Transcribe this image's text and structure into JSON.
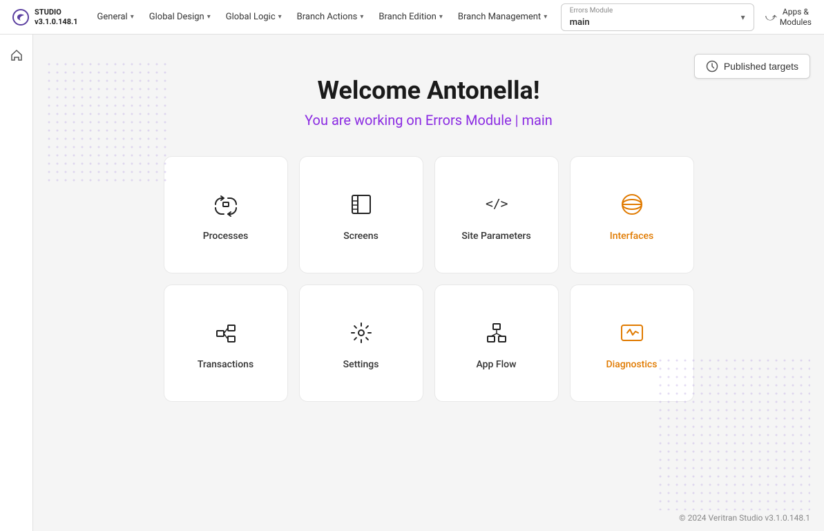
{
  "app": {
    "name": "STUDIO",
    "version": "v3.1.0.148.1"
  },
  "nav": {
    "items": [
      {
        "id": "general",
        "label": "General",
        "hasDropdown": true
      },
      {
        "id": "global-design",
        "label": "Global Design",
        "hasDropdown": true
      },
      {
        "id": "global-logic",
        "label": "Global Logic",
        "hasDropdown": true
      },
      {
        "id": "branch-actions",
        "label": "Branch Actions",
        "hasDropdown": true
      },
      {
        "id": "branch-edition",
        "label": "Branch Edition",
        "hasDropdown": true
      },
      {
        "id": "branch-management",
        "label": "Branch Management",
        "hasDropdown": true
      }
    ],
    "module": {
      "label": "Errors Module",
      "value": "main"
    },
    "apps": {
      "label": "Apps &\nModules",
      "icon": "→"
    }
  },
  "sidebar": {
    "home_label": "Home"
  },
  "published_targets": {
    "label": "Published targets"
  },
  "welcome": {
    "title": "Welcome Antonella!",
    "subtitle": "You are working on Errors Module | main"
  },
  "cards": [
    {
      "id": "processes",
      "label": "Processes",
      "icon": "processes"
    },
    {
      "id": "screens",
      "label": "Screens",
      "icon": "screens"
    },
    {
      "id": "site-parameters",
      "label": "Site Parameters",
      "icon": "site-parameters"
    },
    {
      "id": "interfaces",
      "label": "Interfaces",
      "icon": "interfaces",
      "accent": true
    },
    {
      "id": "transactions",
      "label": "Transactions",
      "icon": "transactions"
    },
    {
      "id": "settings",
      "label": "Settings",
      "icon": "settings"
    },
    {
      "id": "app-flow",
      "label": "App Flow",
      "icon": "app-flow"
    },
    {
      "id": "diagnostics",
      "label": "Diagnostics",
      "icon": "diagnostics",
      "accent": true
    }
  ],
  "footer": {
    "text": "© 2024 Veritran Studio v3.1.0.148.1"
  },
  "colors": {
    "accent": "#e07a00",
    "purple": "#8b2be2",
    "nav_bg": "#ffffff",
    "card_bg": "#ffffff"
  }
}
